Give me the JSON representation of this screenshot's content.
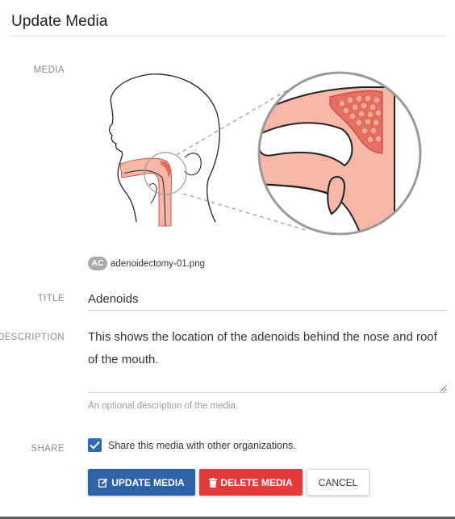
{
  "dialog": {
    "title": "Update Media"
  },
  "labels": {
    "media": "MEDIA",
    "title": "TITLE",
    "description": "DESCRIPTION",
    "share": "SHARE"
  },
  "media": {
    "badge": "AC",
    "file_name": "adenoidectomy-01.png",
    "image_icon": "adenoid-anatomy-illustration"
  },
  "form": {
    "title_value": "Adenoids",
    "description_value": "This shows the location of the adenoids behind the nose and roof of the mouth.",
    "description_helper": "An optional description of the media.",
    "share_checked": true,
    "share_label": "Share this media with other organizations."
  },
  "buttons": {
    "update": "UPDATE MEDIA",
    "update_icon": "edit-icon",
    "delete": "DELETE MEDIA",
    "delete_icon": "trash-icon",
    "cancel": "CANCEL"
  },
  "colors": {
    "primary": "#2e62a7",
    "danger": "#e13b3b",
    "checkbox": "#3268b3"
  }
}
